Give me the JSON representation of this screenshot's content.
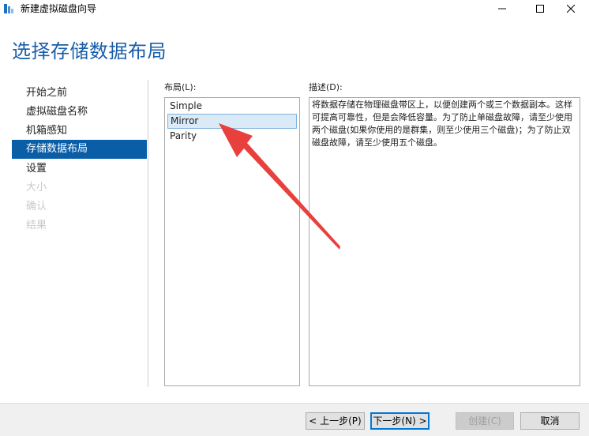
{
  "window": {
    "title": "新建虚拟磁盘向导",
    "minimize_glyph": "—",
    "maximize_glyph": "☐",
    "close_glyph": "✕"
  },
  "page": {
    "heading": "选择存储数据布局"
  },
  "nav": {
    "items": [
      {
        "label": "开始之前",
        "state": "normal"
      },
      {
        "label": "虚拟磁盘名称",
        "state": "normal"
      },
      {
        "label": "机箱感知",
        "state": "normal"
      },
      {
        "label": "存储数据布局",
        "state": "active"
      },
      {
        "label": "设置",
        "state": "normal"
      },
      {
        "label": "大小",
        "state": "disabled"
      },
      {
        "label": "确认",
        "state": "disabled"
      },
      {
        "label": "结果",
        "state": "disabled"
      }
    ]
  },
  "layout": {
    "label": "布局(L):",
    "options": [
      "Simple",
      "Mirror",
      "Parity"
    ],
    "selected": "Mirror"
  },
  "description": {
    "label": "描述(D):",
    "text": "将数据存储在物理磁盘带区上，以便创建两个或三个数据副本。这样可提高可靠性，但是会降低容量。为了防止单磁盘故障，请至少使用两个磁盘(如果你使用的是群集，则至少使用三个磁盘)；为了防止双磁盘故障，请至少使用五个磁盘。"
  },
  "buttons": {
    "prev": "< 上一步(P)",
    "next": "下一步(N) >",
    "create": "创建(C)",
    "cancel": "取消"
  },
  "colors": {
    "accent": "#0a5ea8",
    "heading": "#1a5ea8",
    "annotation_arrow": "#e8403c"
  }
}
